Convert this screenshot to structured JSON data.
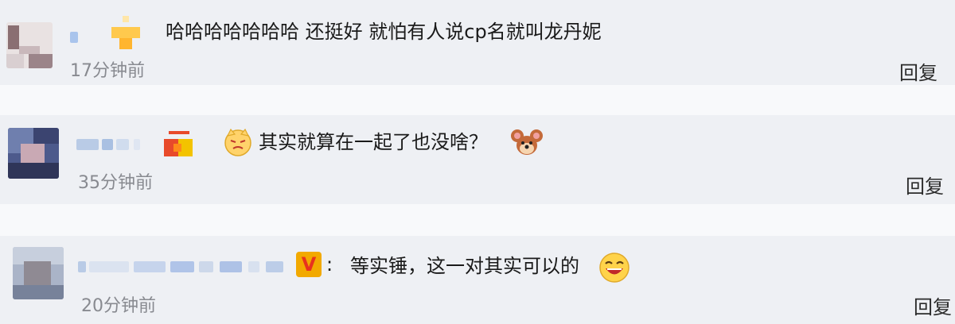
{
  "comments": [
    {
      "text": "哈哈哈哈哈哈哈 还挺好 就怕有人说cp名就叫龙丹妮",
      "time": "17分钟前",
      "reply_label": "回复"
    },
    {
      "text": "其实就算在一起了也没啥？",
      "time": "35分钟前",
      "reply_label": "回复",
      "emoji_before": "cat-face-emoji",
      "emoji_after": "jerry-mouse-emoji"
    },
    {
      "verified_badge": "V",
      "separator": ":",
      "text": "等实锤，这一对其实可以的",
      "time": "20分钟前",
      "reply_label": "回复",
      "emoji_after": "laughing-face-emoji"
    }
  ],
  "colors": {
    "background": "#eef0f4",
    "separator": "#f8f9fb",
    "time": "#888a90",
    "name_blur": "#b9cbe6",
    "verified_badge": "#f2a900",
    "badge_red": "#e84a2a"
  }
}
